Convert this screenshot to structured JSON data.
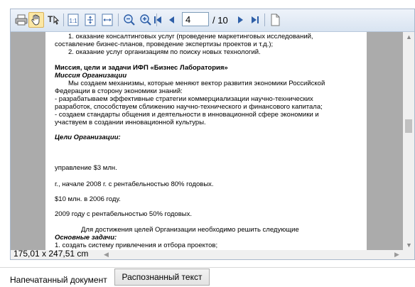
{
  "toolbar": {
    "page_input": "4",
    "page_total": "/ 10",
    "icons": [
      "print-icon",
      "hand-tool-icon",
      "text-select-icon",
      "actual-size-icon",
      "fit-page-icon",
      "fit-width-icon",
      "zoom-out-icon",
      "zoom-in-icon",
      "first-page-icon",
      "prev-page-icon",
      "next-page-icon",
      "last-page-icon",
      "page-icon"
    ]
  },
  "document": {
    "lines": [
      "1. оказание консалтинговых услуг (проведение маркетинговых исследований,",
      "составление бизнес-планов, проведение экспертизы проектов и т.д.);",
      "2. оказание услуг организациям по поиску новых технологий.",
      "Миссия, цели и задачи ИФП «Бизнес Лаборатория»",
      "Миссия Организации",
      "Мы создаем механизмы, которые меняют вектор развития экономики Российской",
      "Федерации в сторону экономики знаний:",
      "- разрабатываем эффективные стратегии коммерциализации научно-технических",
      "разработок, способствуем сближению научно-технического и финансового капитала;",
      "- создаем стандарты общения и деятельности в инновационной сфере экономики и",
      "участвуем в создании инновационной культуры.",
      "Цели Организации:",
      "управление $3 млн.",
      "г., начале 2008 г. с рентабельностью 80% годовых.",
      "$10 млн. в 2006 году.",
      "2009 году с рентабельностью 50% годовых.",
      "Для достижения целей Организации необходимо решить следующие",
      "Основные задачи:",
      "1. создать систему привлечения и отбора проектов;"
    ]
  },
  "status": {
    "page_size": "175,01 x 247,51 cm"
  },
  "tabs": {
    "printed": "Напечатанный документ",
    "recognized": "Распознанный текст"
  },
  "colors": {
    "toolbar_bg": "#dce6f2",
    "page_bg": "#ffffff",
    "canvas_bg": "#ababab",
    "active_tool": "#fbe7a4",
    "nav_blue": "#2e5fa8"
  }
}
